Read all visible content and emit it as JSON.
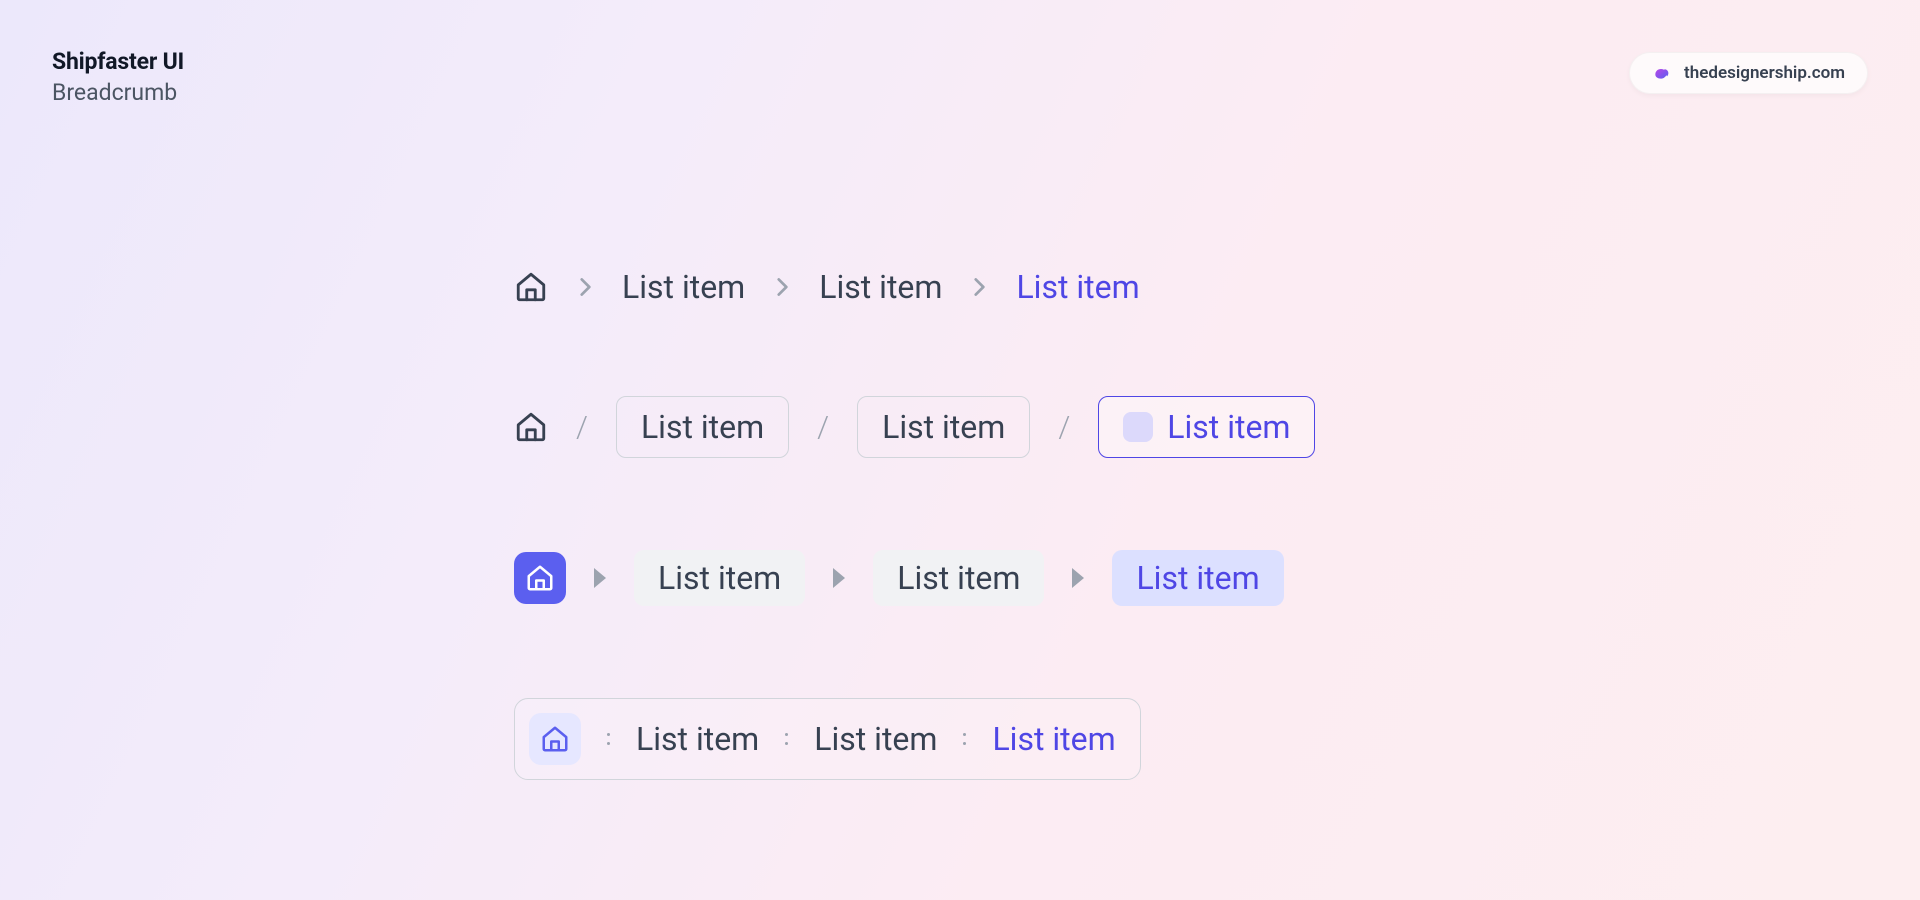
{
  "header": {
    "title": "Shipfaster UI",
    "subtitle": "Breadcrumb"
  },
  "badge": {
    "text": "thedesignership.com"
  },
  "rows": {
    "r1": {
      "i1": "List item",
      "i2": "List item",
      "i3": "List item"
    },
    "r2": {
      "i1": "List item",
      "i2": "List item",
      "i3": "List item"
    },
    "r3": {
      "i1": "List item",
      "i2": "List item",
      "i3": "List item"
    },
    "r4": {
      "i1": "List item",
      "i2": "List item",
      "i3": "List item"
    }
  }
}
